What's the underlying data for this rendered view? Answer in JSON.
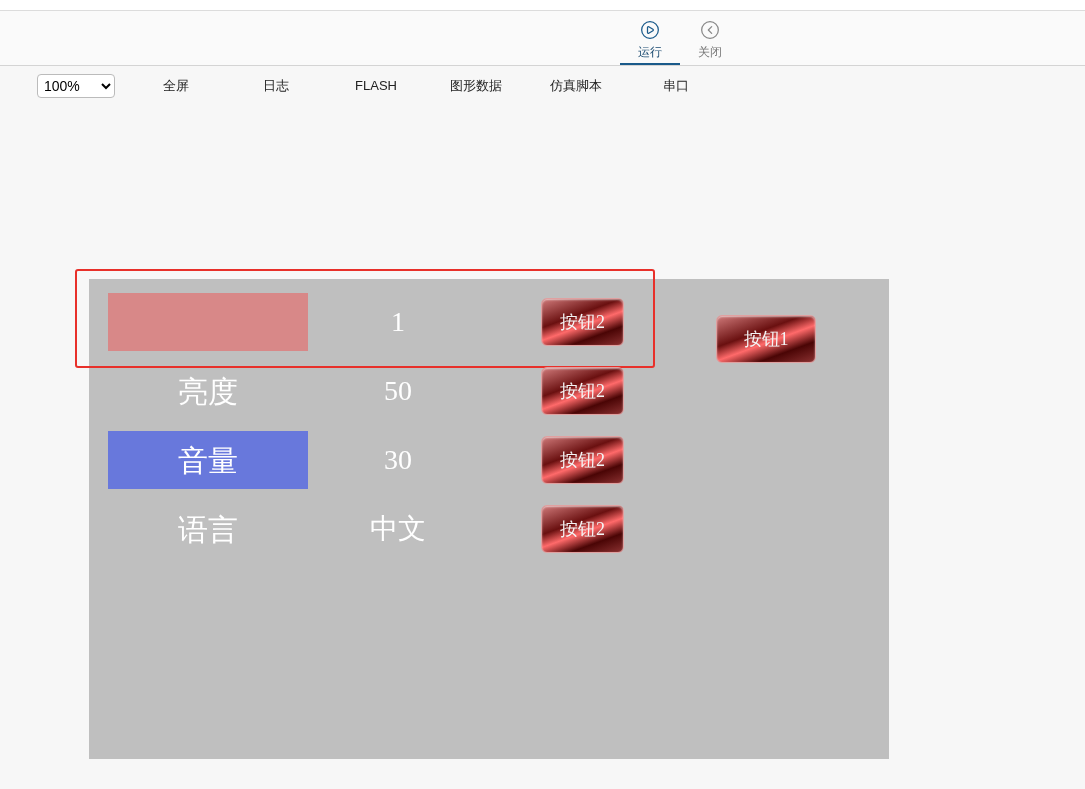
{
  "top_tabs": [
    {
      "label": "运行",
      "selected": true
    },
    {
      "label": "关闭",
      "selected": false
    }
  ],
  "toolbar": {
    "zoom": "100%",
    "items": [
      "全屏",
      "日志",
      "FLASH",
      "图形数据",
      "仿真脚本",
      "串口"
    ]
  },
  "panel": {
    "rows": [
      {
        "color": "#d88888",
        "value": "1",
        "button": "按钮2",
        "selected": true
      },
      {
        "label": "亮度",
        "value": "50",
        "button": "按钮2",
        "selected": false
      },
      {
        "label": "音量",
        "color": "#6878dc",
        "value": "30",
        "button": "按钮2",
        "selected": false
      },
      {
        "label": "语言",
        "value": "中文",
        "button": "按钮2",
        "selected": false
      }
    ],
    "side_button": "按钮1"
  }
}
